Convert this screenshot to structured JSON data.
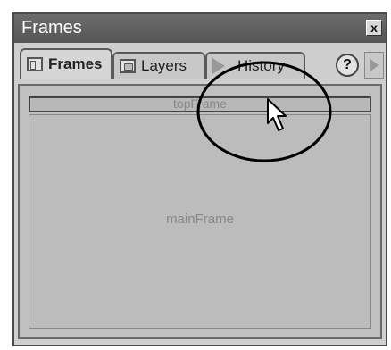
{
  "window": {
    "title": "Frames",
    "close_label": "x"
  },
  "tabs": [
    {
      "label": "Frames",
      "icon": "frames-icon",
      "active": true
    },
    {
      "label": "Layers",
      "icon": "layers-icon",
      "active": false
    },
    {
      "label": "History",
      "icon": "history-icon",
      "active": false
    }
  ],
  "toolbar": {
    "help_label": "?",
    "scroll_icon": "chevron-right-icon"
  },
  "frames": {
    "top_frame_label": "topFrame",
    "main_frame_label": "mainFrame"
  },
  "annotation": {
    "shape": "ellipse",
    "pointer": "cursor-arrow-icon"
  }
}
